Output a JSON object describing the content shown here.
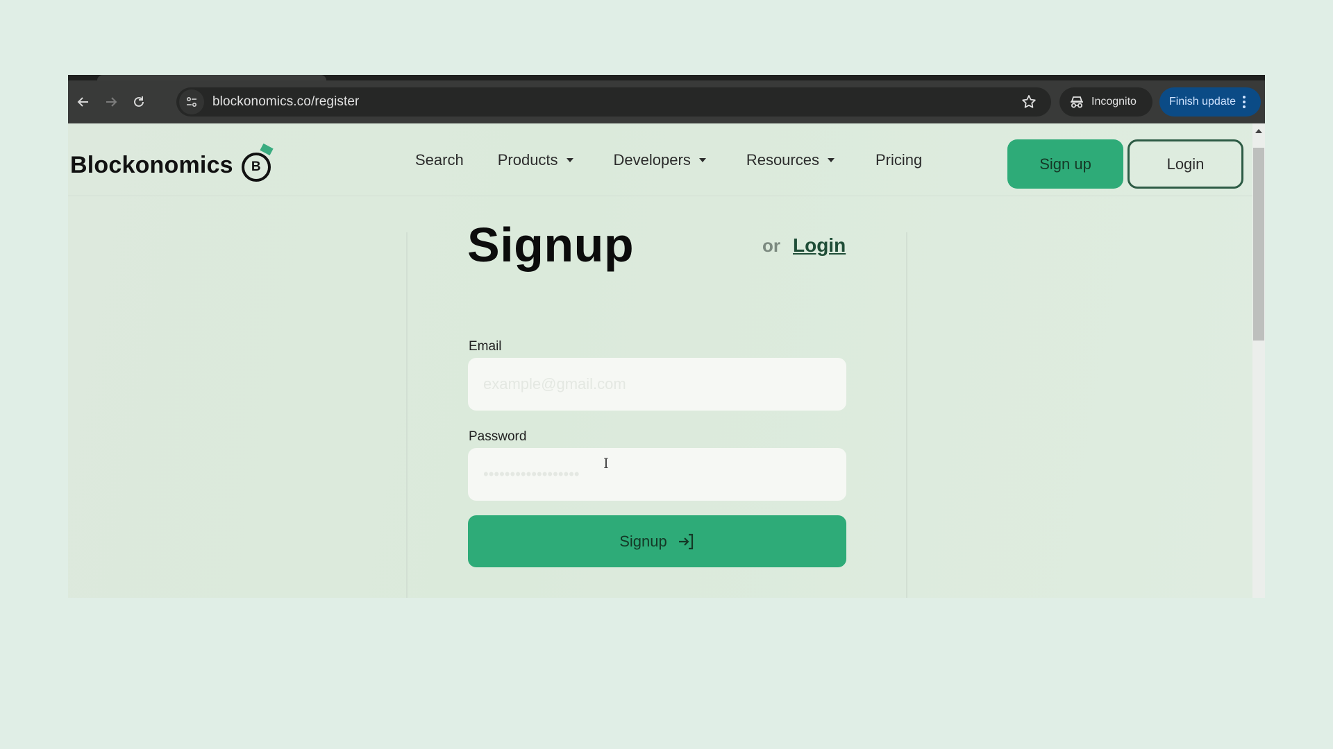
{
  "browser": {
    "url": "blockonomics.co/register",
    "incognito_label": "Incognito",
    "finish_update_label": "Finish update",
    "icons": {
      "back": "arrow-left-icon",
      "forward": "arrow-right-icon",
      "reload": "reload-icon",
      "site_info": "tune-icon",
      "bookmark": "star-icon",
      "incognito": "incognito-icon",
      "menu": "kebab-menu-icon"
    },
    "colors": {
      "update_button": "#0b4b86",
      "toolbar": "#393a39"
    }
  },
  "site": {
    "brand": "Blockonomics",
    "logo_letter": "B",
    "nav": [
      {
        "label": "Search",
        "dropdown": false
      },
      {
        "label": "Products",
        "dropdown": true
      },
      {
        "label": "Developers",
        "dropdown": true
      },
      {
        "label": "Resources",
        "dropdown": true
      },
      {
        "label": "Pricing",
        "dropdown": false
      }
    ],
    "signup_button": "Sign up",
    "login_button": "Login",
    "colors": {
      "accent": "#2eab78",
      "dark_green": "#2d5b45"
    }
  },
  "form": {
    "title": "Signup",
    "or_text": "or",
    "login_link": "Login",
    "email_label": "Email",
    "email_placeholder": "example@gmail.com",
    "email_value": "",
    "password_label": "Password",
    "password_placeholder": "••••••••••••••••••",
    "password_value": "",
    "submit_label": "Signup",
    "submit_icon": "login-arrow-icon"
  },
  "cursor": "I"
}
